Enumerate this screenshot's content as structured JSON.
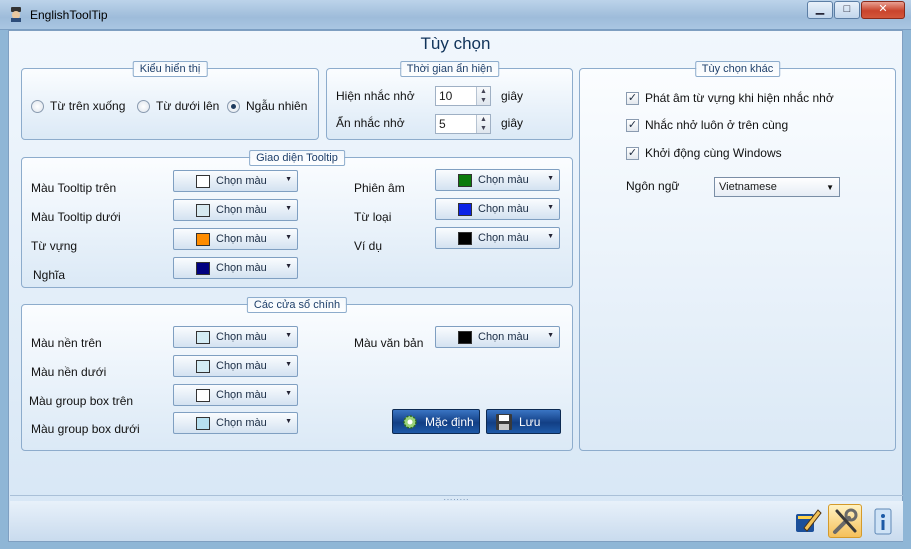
{
  "window": {
    "title": "EnglishToolTip",
    "minimize_symbol": "▁",
    "maximize_symbol": "□",
    "close_symbol": "✕"
  },
  "heading": "Tùy chọn",
  "display_mode": {
    "title": "Kiểu hiển thị",
    "options": [
      {
        "label": "Từ trên xuống",
        "selected": false
      },
      {
        "label": "Từ dưới lên",
        "selected": false
      },
      {
        "label": "Ngẫu nhiên",
        "selected": true
      }
    ]
  },
  "timing": {
    "title": "Thời gian ẩn hiện",
    "rows": [
      {
        "label": "Hiện nhắc nhở",
        "value": "10",
        "unit": "giây"
      },
      {
        "label": "Ẩn nhắc nhở",
        "value": "5",
        "unit": "giây"
      }
    ]
  },
  "other_options": {
    "title": "Tùy chọn khác",
    "checks": [
      {
        "label": "Phát âm từ vựng khi hiện nhắc nhở",
        "checked": true
      },
      {
        "label": "Nhắc nhở luôn ở trên cùng",
        "checked": true
      },
      {
        "label": "Khởi động cùng Windows",
        "checked": true
      }
    ],
    "language_label": "Ngôn ngữ",
    "language_value": "Vietnamese"
  },
  "tooltip_ui": {
    "title": "Giao diện Tooltip",
    "pick_label": "Chọn màu",
    "left": [
      {
        "label": "Màu Tooltip trên",
        "color": "#ffffff"
      },
      {
        "label": "Màu Tooltip dưới",
        "color": "#d7e9f0"
      },
      {
        "label": "Từ vựng",
        "color": "#ff8c00"
      },
      {
        "label": "Nghĩa",
        "color": "#000080"
      }
    ],
    "right": [
      {
        "label": "Phiên âm",
        "color": "#0b7a0b"
      },
      {
        "label": "Từ loại",
        "color": "#0a22e6"
      },
      {
        "label": "Ví dụ",
        "color": "#000000"
      }
    ]
  },
  "main_window": {
    "title": "Các cửa sổ chính",
    "pick_label": "Chọn màu",
    "left": [
      {
        "label": "Màu nền trên",
        "color": "#d4ecf4"
      },
      {
        "label": "Màu nền dưới",
        "color": "#d4ecf4"
      },
      {
        "label": "Màu group box trên",
        "color": "#ffffff"
      },
      {
        "label": "Màu group box dưới",
        "color": "#b7e0f0"
      }
    ],
    "text_color": {
      "label": "Màu văn bản",
      "color": "#000000"
    },
    "default_button": "Mặc định",
    "save_button": "Lưu"
  },
  "splitter_grip": "........",
  "icons": [
    "app-icon",
    "dictionary-pen-icon",
    "tools-icon",
    "about-info-icon",
    "gear-icon",
    "floppy-disk-icon"
  ]
}
